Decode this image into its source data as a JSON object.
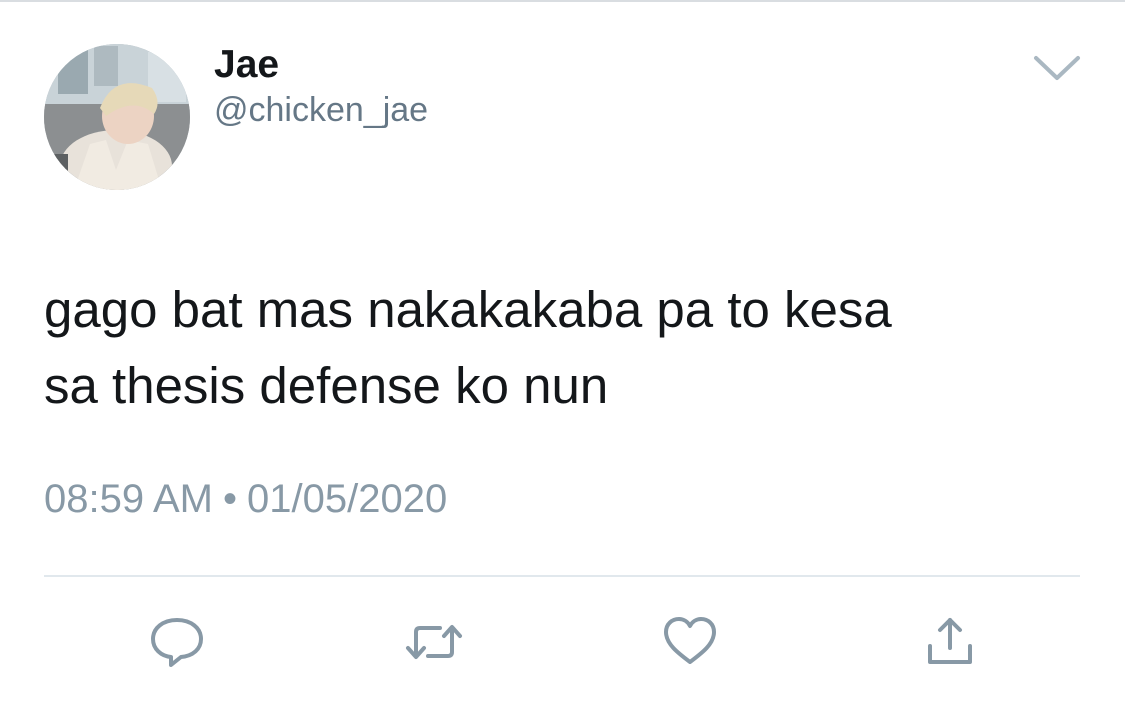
{
  "tweet": {
    "author": {
      "display_name": "Jae",
      "handle": "@chicken_jae"
    },
    "text_lines": [
      "gago bat mas nakakakaba pa to kesa",
      "sa thesis defense ko nun"
    ],
    "time": "08:59 AM",
    "separator": "•",
    "date": "01/05/2020"
  },
  "icons": {
    "more": "chevron-down-icon",
    "reply": "reply-icon",
    "retweet": "retweet-icon",
    "like": "heart-icon",
    "share": "share-icon"
  },
  "colors": {
    "text_primary": "#14171a",
    "text_secondary": "#657786",
    "icon_gray": "#8899a6",
    "divider": "#e1e8ed"
  }
}
